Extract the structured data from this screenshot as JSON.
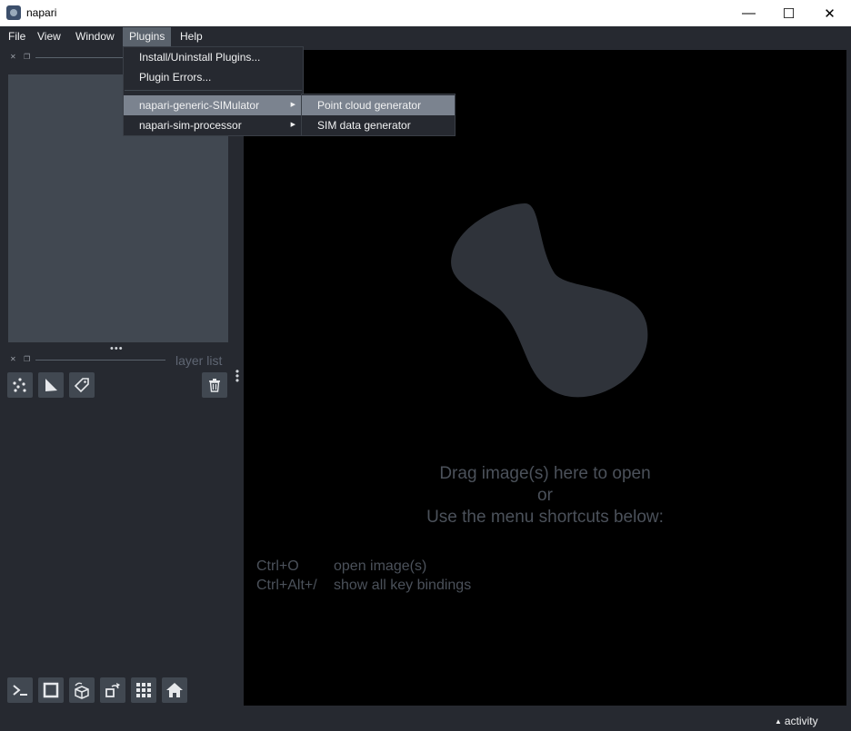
{
  "window": {
    "title": "napari"
  },
  "window_controls": {
    "minimize": "—",
    "maximize": "☐",
    "close": "✕"
  },
  "menubar": [
    {
      "label": "File"
    },
    {
      "label": "View"
    },
    {
      "label": "Window"
    },
    {
      "label": "Plugins"
    },
    {
      "label": "Help"
    }
  ],
  "plugins_menu": {
    "items": [
      {
        "label": "Install/Uninstall Plugins..."
      },
      {
        "label": "Plugin Errors..."
      },
      {
        "label": "napari-generic-SIMulator",
        "has_submenu": true
      },
      {
        "label": "napari-sim-processor",
        "has_submenu": true
      }
    ]
  },
  "submenu": {
    "items": [
      {
        "label": "Point cloud generator"
      },
      {
        "label": "SIM data generator"
      }
    ]
  },
  "left_panel": {
    "layer_list_label": "layer list",
    "resize_dots": "•••",
    "layer_buttons": [
      "points-icon",
      "shapes-icon",
      "labels-icon"
    ],
    "delete_button": "trash-icon",
    "viewer_buttons": [
      "console-icon",
      "ndisplay-icon",
      "roll-icon",
      "transpose-icon",
      "grid-icon",
      "home-icon"
    ]
  },
  "canvas": {
    "welcome_line1": "Drag image(s) here to open",
    "welcome_line2": "or",
    "welcome_line3": "Use the menu shortcuts below:",
    "shortcuts": [
      {
        "keys": "Ctrl+O",
        "action": "open image(s)"
      },
      {
        "keys": "Ctrl+Alt+/",
        "action": "show all key bindings"
      }
    ]
  },
  "status": {
    "activity": "activity"
  },
  "colors": {
    "background": "#262930",
    "panel": "#414851",
    "canvas": "#000000",
    "highlight": "#7b838f",
    "logo": "#2f333a"
  }
}
